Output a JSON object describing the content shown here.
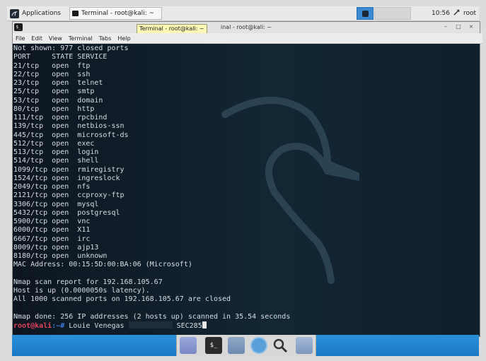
{
  "topbar": {
    "apps_label": "Applications",
    "task_label": "Terminal - root@kali: ~",
    "clock": "10:56",
    "user": "root"
  },
  "window": {
    "title": "Terminal - root@kali: ~",
    "title_visible": "inal - root@kali: ~",
    "tooltip": "Terminal - root@kali: ~",
    "tb_icon_text": "$_"
  },
  "menu": [
    "File",
    "Edit",
    "View",
    "Terminal",
    "Tabs",
    "Help"
  ],
  "terminal": {
    "lines": [
      "Not shown: 977 closed ports",
      "PORT     STATE SERVICE",
      "21/tcp   open  ftp",
      "22/tcp   open  ssh",
      "23/tcp   open  telnet",
      "25/tcp   open  smtp",
      "53/tcp   open  domain",
      "80/tcp   open  http",
      "111/tcp  open  rpcbind",
      "139/tcp  open  netbios-ssn",
      "445/tcp  open  microsoft-ds",
      "512/tcp  open  exec",
      "513/tcp  open  login",
      "514/tcp  open  shell",
      "1099/tcp open  rmiregistry",
      "1524/tcp open  ingreslock",
      "2049/tcp open  nfs",
      "2121/tcp open  ccproxy-ftp",
      "3306/tcp open  mysql",
      "5432/tcp open  postgresql",
      "5900/tcp open  vnc",
      "6000/tcp open  X11",
      "6667/tcp open  irc",
      "8009/tcp open  ajp13",
      "8180/tcp open  unknown",
      "MAC Address: 00:15:5D:00:BA:06 (Microsoft)",
      "",
      "Nmap scan report for 192.168.105.67",
      "Host is up (0.0000050s latency).",
      "All 1000 scanned ports on 192.168.105.67 are closed",
      "",
      "Nmap done: 256 IP addresses (2 hosts up) scanned in 35.54 seconds"
    ],
    "prompt_host": "root@kali",
    "prompt_path": ":~# ",
    "typed_before": "Louie Venegas ",
    "typed_after": " SEC285"
  },
  "dock_terminal_text": "$_"
}
